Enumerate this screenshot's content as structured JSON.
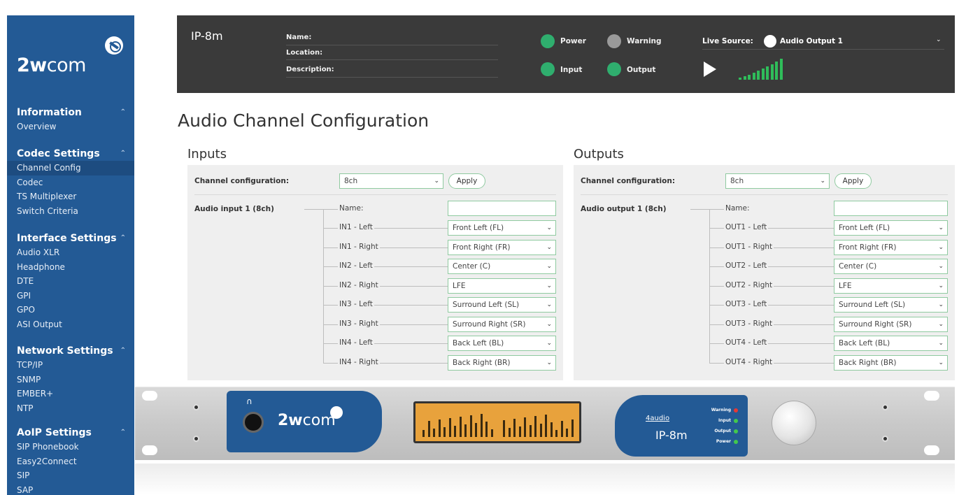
{
  "sidebar": {
    "logo": {
      "bold": "2w",
      "thin": "com"
    },
    "groups": [
      {
        "title": "Information",
        "items": [
          "Overview"
        ]
      },
      {
        "title": "Codec Settings",
        "items": [
          "Channel Config",
          "Codec",
          "TS Multiplexer",
          "Switch Criteria"
        ]
      },
      {
        "title": "Interface Settings",
        "items": [
          "Audio XLR",
          "Headphone",
          "DTE",
          "GPI",
          "GPO",
          "ASI Output"
        ]
      },
      {
        "title": "Network Settings",
        "items": [
          "TCP/IP",
          "SNMP",
          "EMBER+",
          "NTP"
        ]
      },
      {
        "title": "AoIP Settings",
        "items": [
          "SIP Phonebook",
          "Easy2Connect",
          "SIP",
          "SAP"
        ]
      }
    ],
    "active_item": "Channel Config"
  },
  "header": {
    "device_name": "IP-8m",
    "name_label": "Name:",
    "location_label": "Location:",
    "description_label": "Description:",
    "leds": {
      "power": {
        "label": "Power",
        "color": "#2fae6e"
      },
      "warning": {
        "label": "Warning",
        "color": "#9a9a9a"
      },
      "input": {
        "label": "Input",
        "color": "#2fae6e"
      },
      "output": {
        "label": "Output",
        "color": "#2fae6e"
      }
    },
    "live_source_label": "Live Source:",
    "live_source_value": "Audio Output 1"
  },
  "page_title": "Audio Channel Configuration",
  "inputs": {
    "title": "Inputs",
    "config_label": "Channel configuration:",
    "config_value": "8ch",
    "apply_label": "Apply",
    "group_label": "Audio input 1 (8ch)",
    "name_label": "Name:",
    "name_value": "",
    "channels": [
      {
        "label": "IN1 - Left",
        "value": "Front Left (FL)"
      },
      {
        "label": "IN1 - Right",
        "value": "Front Right (FR)"
      },
      {
        "label": "IN2 - Left",
        "value": "Center (C)"
      },
      {
        "label": "IN2 - Right",
        "value": "LFE"
      },
      {
        "label": "IN3 - Left",
        "value": "Surround Left (SL)"
      },
      {
        "label": "IN3 - Right",
        "value": "Surround Right (SR)"
      },
      {
        "label": "IN4 - Left",
        "value": "Back Left (BL)"
      },
      {
        "label": "IN4 - Right",
        "value": "Back Right (BR)"
      }
    ]
  },
  "outputs": {
    "title": "Outputs",
    "config_label": "Channel configuration:",
    "config_value": "8ch",
    "apply_label": "Apply",
    "group_label": "Audio output 1 (8ch)",
    "name_label": "Name:",
    "name_value": "",
    "channels": [
      {
        "label": "OUT1 - Left",
        "value": "Front Left (FL)"
      },
      {
        "label": "OUT1 - Right",
        "value": "Front Right (FR)"
      },
      {
        "label": "OUT2 - Left",
        "value": "Center (C)"
      },
      {
        "label": "OUT2 - Right",
        "value": "LFE"
      },
      {
        "label": "OUT3 - Left",
        "value": "Surround Left (SL)"
      },
      {
        "label": "OUT3 - Right",
        "value": "Surround Right (SR)"
      },
      {
        "label": "OUT4 - Left",
        "value": "Back Left (BL)"
      },
      {
        "label": "OUT4 - Right",
        "value": "Back Right (BR)"
      }
    ]
  },
  "device_image": {
    "logo": {
      "bold": "2w",
      "thin": "com"
    },
    "brand": "4audio",
    "model": "IP-8m",
    "leds": [
      {
        "label": "Warning",
        "color": "#e53935"
      },
      {
        "label": "Input",
        "color": "#43c84d"
      },
      {
        "label": "Output",
        "color": "#43c84d"
      },
      {
        "label": "Power",
        "color": "#43c84d"
      }
    ]
  },
  "icons": {
    "play": "play-icon",
    "live_source": "source-icon",
    "headphones": "headphones-icon",
    "caret": "chevron-down-icon"
  }
}
